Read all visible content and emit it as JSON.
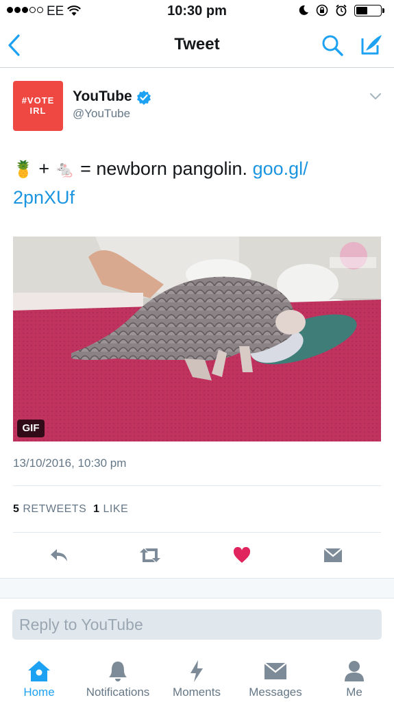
{
  "status_bar": {
    "carrier": "EE",
    "time": "10:30 pm",
    "signal_bars": 3,
    "battery_level": 0.42
  },
  "nav": {
    "title": "Tweet",
    "back_icon": "chevron-left-icon",
    "search_icon": "search-icon",
    "compose_icon": "compose-icon"
  },
  "tweet": {
    "avatar": {
      "line1": "#VOTE",
      "line2": "IRL"
    },
    "display_name": "YouTube",
    "handle": "@YouTube",
    "verified": true,
    "text": {
      "emoji_1": "🍍",
      "plus": "+",
      "emoji_2": "🐁",
      "body": "= newborn pangolin.",
      "link_part1": "goo.gl/",
      "link_part2": "2pnXUf"
    },
    "media_badge": "GIF",
    "timestamp": "13/10/2016, 10:30 pm",
    "stats": {
      "retweets_count": "5",
      "retweets_label": "RETWEETS",
      "likes_count": "1",
      "likes_label": "LIKE"
    },
    "liked": true
  },
  "reply": {
    "placeholder": "Reply to YouTube"
  },
  "tab_bar": {
    "items": [
      {
        "label": "Home",
        "icon": "home-icon",
        "active": true
      },
      {
        "label": "Notifications",
        "icon": "bell-icon",
        "active": false
      },
      {
        "label": "Moments",
        "icon": "lightning-icon",
        "active": false
      },
      {
        "label": "Messages",
        "icon": "envelope-icon",
        "active": false
      },
      {
        "label": "Me",
        "icon": "person-icon",
        "active": false
      }
    ]
  },
  "colors": {
    "accent": "#1da1f2",
    "link": "#1b95e0",
    "like": "#e0245e",
    "avatar_bg": "#ef4742",
    "muted": "#657786"
  }
}
